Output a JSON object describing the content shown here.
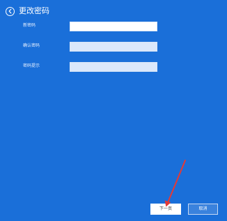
{
  "window": {
    "title": "更改密码",
    "background": "#1a6fd9"
  },
  "form": {
    "fields": [
      {
        "label": "新密码",
        "value": "",
        "placeholder": ""
      },
      {
        "label": "确认密码",
        "value": "",
        "placeholder": ""
      },
      {
        "label": "密码提示",
        "value": "",
        "placeholder": ""
      }
    ]
  },
  "buttons": {
    "next_label": "下一页",
    "cancel_label": "取消"
  },
  "annotation": {
    "arrow_color": "#e53935"
  },
  "icons": {
    "back": "back-arrow-circle-icon",
    "annotation": "red-arrow-icon"
  }
}
